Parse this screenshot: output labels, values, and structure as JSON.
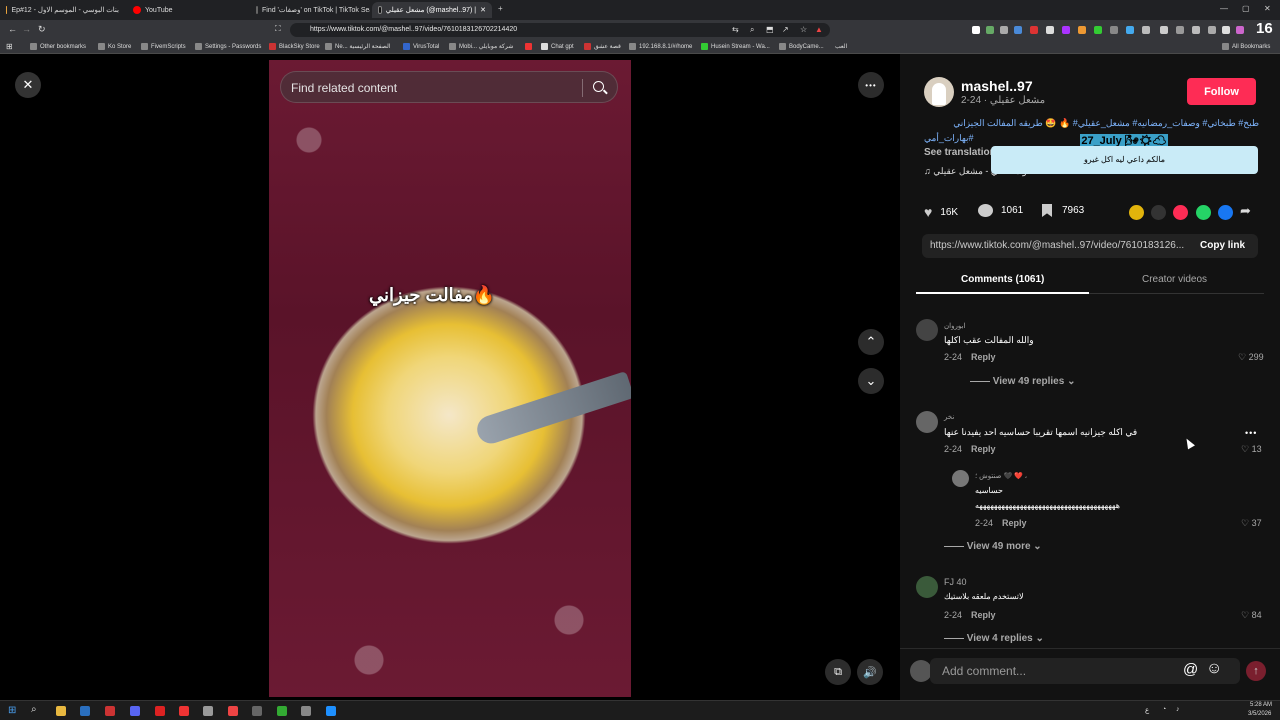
{
  "browser": {
    "tabs": [
      {
        "label": "Ep#12 - بنات البوسي - الموسم الاول"
      },
      {
        "label": "YouTube"
      },
      {
        "label": "Find 'وصفات' on TikTok | TikTok Sea..."
      },
      {
        "label": "مشعل عقيلي (@mashel..97) |"
      }
    ],
    "url": "https://www.tiktok.com/@mashel..97/video/7610183126702214420",
    "bookmarks": [
      "Other bookmarks",
      "Ko Store",
      "FivemScripts",
      "Settings - Passwords",
      "BlackSky Store",
      "Ne... الصفحة الرئيسية",
      "VirusTotal",
      "Mobi... شركة موبايلي",
      "Chat gpt",
      "قصة عشق",
      "192.168.8.1/#/home",
      "Husein Stream - Wa...",
      "BodyCame...",
      "العب",
      "All Bookmarks"
    ],
    "badge_num": "16"
  },
  "video": {
    "search_placeholder": "Find related content",
    "caption": "مفالت جيزاني🔥"
  },
  "author": {
    "username": "mashel..97",
    "meta": "2-24 · مشعل عقيلي",
    "follow_label": "Follow"
  },
  "description": {
    "line1": "طبخ# طبخاتي# وصفات_رمضانيه# مشعل_عقيلي# 🔥 🤩 طريقه المفالت الجيزاني",
    "line2": "بهارات_أمي#",
    "see_translation": "See translation",
    "music": "♫ صوت أصلي - مشعل عقيلي"
  },
  "stats": {
    "likes": "16K",
    "comments": "1061",
    "saves": "7963"
  },
  "link": {
    "url": "https://www.tiktok.com/@mashel..97/video/7610183126...",
    "copy_label": "Copy link"
  },
  "tabs": {
    "comments": "Comments (1061)",
    "creator": "Creator videos"
  },
  "comments": [
    {
      "user": "ابوروان",
      "text": "والله المفالت عقب اكلها",
      "date": "2-24",
      "reply": "Reply",
      "likes": "299",
      "view_more": "View 49 replies"
    },
    {
      "user": "نخر",
      "text": "في اكله جيزانيه اسمها تقريبا حساسيه احد يفيدنا عنها",
      "date": "2-24",
      "reply": "Reply",
      "likes": "13"
    },
    {
      "user": "صنتوش ؛ 🖤 ❤️ ،",
      "text": "حساسيه",
      "text2": "ههههههههههههههههههههههههههههههههههههههه",
      "date": "2-24",
      "reply": "Reply",
      "likes": "37",
      "view_more": "View 49 more"
    },
    {
      "user": "FJ 40",
      "text": "لاتستخدم ملعقه بلاستيك",
      "date": "2-24",
      "reply": "Reply",
      "likes": "84",
      "view_more": "View 4 replies"
    }
  ],
  "comment_input": {
    "placeholder": "Add comment...",
    "at": "@",
    "emoji": "☺"
  },
  "overlay": {
    "text": "مالكم داعي ليه اكل غيرو",
    "tag": "27_July 🌬☀☁"
  },
  "system": {
    "time": "5:28 AM",
    "date": "3/5/2026"
  },
  "icons": {
    "close": "✕",
    "more": "•••",
    "up": "⌃",
    "down": "⌄",
    "volume": "🔊",
    "floating": "⧉"
  }
}
